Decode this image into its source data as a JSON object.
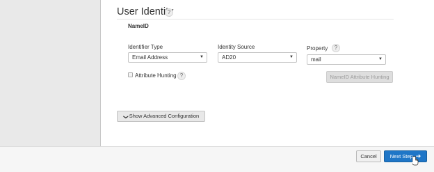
{
  "section": {
    "title": "User Identity",
    "help": "?"
  },
  "nameid": {
    "label": "NameID"
  },
  "fields": {
    "identifier_type": {
      "label": "Identifier Type",
      "value": "Email Address"
    },
    "identity_source": {
      "label": "Identity Source",
      "value": "AD20"
    },
    "property": {
      "label": "Property",
      "help": "?",
      "value": "mail"
    }
  },
  "attribute_hunting": {
    "label": "Attribute Hunting",
    "help": "?",
    "checked": false,
    "button_label": "NameID Attribute Hunting"
  },
  "advanced": {
    "button_label": "Show Advanced Configuration"
  },
  "footer": {
    "cancel_label": "Cancel",
    "next_label": "Next Step"
  },
  "colors": {
    "primary": "#1f76c7",
    "panel": "#e9e9e9"
  },
  "icons": [
    "help-icon",
    "caret-down-icon",
    "chevron-down-icon",
    "arrow-right-icon",
    "hand-cursor-icon"
  ]
}
